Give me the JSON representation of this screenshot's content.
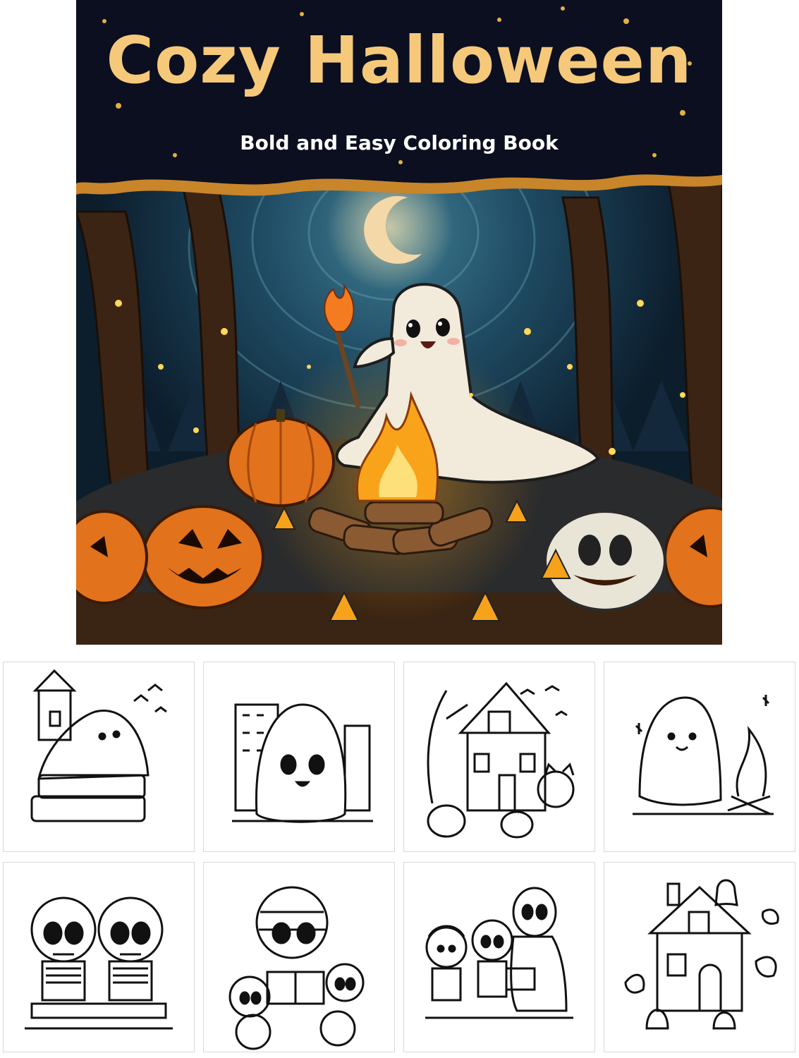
{
  "cover": {
    "title": "Cozy Halloween",
    "subtitle": "Bold and Easy Coloring Book",
    "colors": {
      "title": "#f6c97a",
      "night_sky": "#0b0f1f",
      "forest": "#1f4b63",
      "pumpkin": "#e2721b",
      "fire": "#f9a31a"
    },
    "scene": [
      "moon-icon",
      "ghost-icon",
      "torch-icon",
      "campfire-icon",
      "pumpkin-icon",
      "jack-o-lantern-icon",
      "candy-corn-icon",
      "tree-icon"
    ]
  },
  "thumbnails": [
    {
      "subject": "ghost-on-books-with-castle"
    },
    {
      "subject": "ghost-in-city"
    },
    {
      "subject": "haunted-house-with-cat-and-pumpkins"
    },
    {
      "subject": "ghost-by-campfire"
    },
    {
      "subject": "two-skeletons-picnic"
    },
    {
      "subject": "mummy-reading-with-skulls"
    },
    {
      "subject": "kids-with-mummy-reading"
    },
    {
      "subject": "cottage-with-ghosts"
    }
  ]
}
